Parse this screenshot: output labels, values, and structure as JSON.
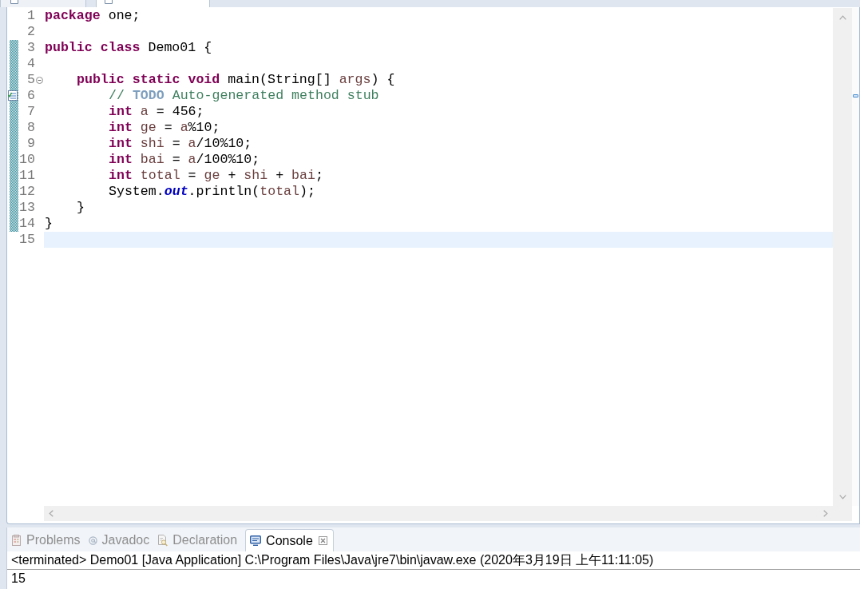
{
  "editor_tabs": [
    {
      "selected": false
    },
    {
      "selected": true
    }
  ],
  "editor": {
    "lines": [
      {
        "number": "1",
        "changed": false,
        "tokens": [
          {
            "kind": "keyword",
            "text": "package "
          },
          {
            "kind": "plain",
            "text": "one;"
          }
        ]
      },
      {
        "number": "2",
        "changed": false
      },
      {
        "number": "3",
        "changed": true,
        "tokens": [
          {
            "kind": "keyword",
            "text": "public "
          },
          {
            "kind": "keyword",
            "text": "class "
          },
          {
            "kind": "plain",
            "text": "Demo01 {"
          }
        ],
        "children": [
          {
            "number": "4",
            "changed": true
          },
          {
            "number": "5",
            "changed": true,
            "expanded": true,
            "tokens": [
              {
                "kind": "keyword",
                "text": "public "
              },
              {
                "kind": "keyword",
                "text": "static "
              },
              {
                "kind": "keyword",
                "text": "void "
              },
              {
                "kind": "plain",
                "text": "main(String[] "
              },
              {
                "kind": "local",
                "text": "args"
              },
              {
                "kind": "plain",
                "text": ") {"
              }
            ],
            "children": [
              {
                "number": "6",
                "changed": true,
                "task": true,
                "tokens": [
                  {
                    "kind": "comment",
                    "text": "// "
                  },
                  {
                    "kind": "task_tag",
                    "text": "TODO"
                  },
                  {
                    "kind": "comment",
                    "text": " Auto-generated method stub"
                  }
                ]
              },
              {
                "number": "7",
                "changed": true,
                "tokens": [
                  {
                    "kind": "keyword",
                    "text": "int "
                  },
                  {
                    "kind": "local",
                    "text": "a"
                  },
                  {
                    "kind": "plain",
                    "text": " = 456;"
                  }
                ]
              },
              {
                "number": "8",
                "changed": true,
                "tokens": [
                  {
                    "kind": "keyword",
                    "text": "int "
                  },
                  {
                    "kind": "local",
                    "text": "ge"
                  },
                  {
                    "kind": "plain",
                    "text": " = "
                  },
                  {
                    "kind": "local",
                    "text": "a"
                  },
                  {
                    "kind": "plain",
                    "text": "%10;"
                  }
                ]
              },
              {
                "number": "9",
                "changed": true,
                "tokens": [
                  {
                    "kind": "keyword",
                    "text": "int "
                  },
                  {
                    "kind": "local",
                    "text": "shi"
                  },
                  {
                    "kind": "plain",
                    "text": " = "
                  },
                  {
                    "kind": "local",
                    "text": "a"
                  },
                  {
                    "kind": "plain",
                    "text": "/10%10;"
                  }
                ]
              },
              {
                "number": "10",
                "changed": true,
                "tokens": [
                  {
                    "kind": "keyword",
                    "text": "int "
                  },
                  {
                    "kind": "local",
                    "text": "bai"
                  },
                  {
                    "kind": "plain",
                    "text": " = "
                  },
                  {
                    "kind": "local",
                    "text": "a"
                  },
                  {
                    "kind": "plain",
                    "text": "/100%10;"
                  }
                ]
              },
              {
                "number": "11",
                "changed": true,
                "tokens": [
                  {
                    "kind": "keyword",
                    "text": "int "
                  },
                  {
                    "kind": "local",
                    "text": "total"
                  },
                  {
                    "kind": "plain",
                    "text": " = "
                  },
                  {
                    "kind": "local",
                    "text": "ge"
                  },
                  {
                    "kind": "plain",
                    "text": " + "
                  },
                  {
                    "kind": "local",
                    "text": "shi"
                  },
                  {
                    "kind": "plain",
                    "text": " + "
                  },
                  {
                    "kind": "local",
                    "text": "bai"
                  },
                  {
                    "kind": "plain",
                    "text": ";"
                  }
                ]
              },
              {
                "number": "12",
                "changed": true,
                "tokens": [
                  {
                    "kind": "plain",
                    "text": "System."
                  },
                  {
                    "kind": "field",
                    "text": "out"
                  },
                  {
                    "kind": "plain",
                    "text": ".println("
                  },
                  {
                    "kind": "local",
                    "text": "total"
                  },
                  {
                    "kind": "plain",
                    "text": ");"
                  }
                ]
              }
            ]
          },
          {
            "number": "13",
            "changed": true,
            "tokens": [
              {
                "kind": "plain",
                "text": "}"
              }
            ]
          }
        ]
      },
      {
        "number": "14",
        "changed": true,
        "tokens": [
          {
            "kind": "plain",
            "text": "}"
          }
        ]
      },
      {
        "number": "15",
        "changed": false,
        "current": true
      }
    ]
  },
  "panel": {
    "tabs": [
      {
        "kind": "problems",
        "label": "Problems",
        "selected": false
      },
      {
        "kind": "javadoc",
        "label": "Javadoc",
        "selected": false
      },
      {
        "kind": "declaration",
        "label": "Declaration",
        "selected": false
      },
      {
        "kind": "console",
        "label": "Console",
        "selected": true,
        "closable": true
      }
    ],
    "console": {
      "header": "<terminated> Demo01 [Java Application] C:\\Program Files\\Java\\jre7\\bin\\javaw.exe (2020年3月19日 上午11:11:05)",
      "output": [
        "15"
      ]
    }
  }
}
